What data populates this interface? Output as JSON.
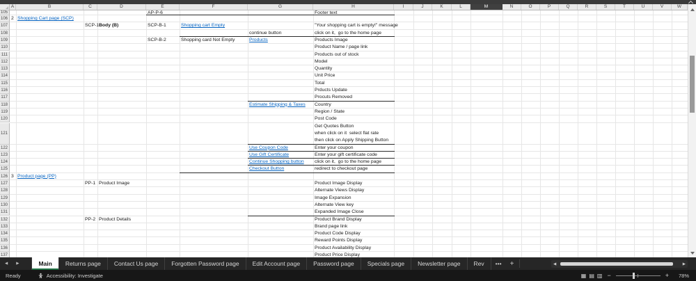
{
  "colors": {
    "link": "#0563c1",
    "selected_column_header_bg": "#404040",
    "section_border": "#2b2b2b",
    "active_tab_underline": "#1f7244",
    "frame_dark": "#262626"
  },
  "frame": {
    "tabs": {
      "nav_left": "◀",
      "nav_right": "▶",
      "items": [
        "Main",
        "Returns page",
        "Contact Us page",
        "Forgotten Password page",
        "Edit Account page",
        "Password page",
        "Specials page",
        "Newsletter page",
        "Rev"
      ],
      "active": "Main",
      "overflow": "•••",
      "add": "+"
    },
    "status": {
      "ready": "Ready",
      "accessibility": "Accessibility: Investigate",
      "zoom_out": "−",
      "zoom_in": "+",
      "zoom": "78%"
    }
  },
  "sheet": {
    "selected_column": "M",
    "columns": [
      "A",
      "B",
      "C",
      "D",
      "E",
      "F",
      "G",
      "H",
      "I",
      "J",
      "K",
      "L",
      "M",
      "N",
      "O",
      "P",
      "Q",
      "R",
      "S",
      "T",
      "U",
      "V",
      "W"
    ],
    "rows": [
      {
        "n": 105,
        "h": 7,
        "cells": [
          {
            "c": "E",
            "t": "AP-P-6"
          },
          {
            "c": "H",
            "t": "Footer text"
          }
        ],
        "border": [
          "E",
          "F",
          "G",
          "H"
        ]
      },
      {
        "n": 106,
        "cells": [
          {
            "c": "A",
            "t": "2"
          },
          {
            "c": "B",
            "t": "Shopping Cart page (SCP)",
            "link": true
          }
        ]
      },
      {
        "n": 107,
        "cells": [
          {
            "c": "C",
            "t": "SCP-1"
          },
          {
            "c": "D",
            "t": "Body (B)",
            "bold": true
          },
          {
            "c": "E",
            "t": "SCP-B-1"
          },
          {
            "c": "F",
            "t": "Shopping cart Empty",
            "link": true
          },
          {
            "c": "H",
            "t": "\"Your shopping cart is empty!\" message"
          }
        ]
      },
      {
        "n": 108,
        "cells": [
          {
            "c": "G",
            "t": "continue button"
          },
          {
            "c": "H",
            "t": "click on it,  go to the home page"
          }
        ],
        "border": [
          "F",
          "G",
          "H"
        ]
      },
      {
        "n": 109,
        "cells": [
          {
            "c": "E",
            "t": "SCP-B-2"
          },
          {
            "c": "F",
            "t": "Shopping card Not Empty"
          },
          {
            "c": "G",
            "t": "Products",
            "link": true
          },
          {
            "c": "H",
            "t": "Products Image"
          }
        ]
      },
      {
        "n": 110,
        "cells": [
          {
            "c": "H",
            "t": "Product Name / page link"
          }
        ]
      },
      {
        "n": 111,
        "cells": [
          {
            "c": "H",
            "t": "Products out of stock"
          }
        ]
      },
      {
        "n": 112,
        "cells": [
          {
            "c": "H",
            "t": "Model"
          }
        ]
      },
      {
        "n": 113,
        "cells": [
          {
            "c": "H",
            "t": "Quantity"
          }
        ]
      },
      {
        "n": 114,
        "cells": [
          {
            "c": "H",
            "t": "Unit Price"
          }
        ]
      },
      {
        "n": 115,
        "cells": [
          {
            "c": "H",
            "t": "Total"
          }
        ]
      },
      {
        "n": 116,
        "cells": [
          {
            "c": "H",
            "t": "Prducts Update"
          }
        ]
      },
      {
        "n": 117,
        "cells": [
          {
            "c": "H",
            "t": "Procuts Removed"
          }
        ],
        "border": [
          "G",
          "H"
        ]
      },
      {
        "n": 118,
        "cells": [
          {
            "c": "G",
            "t": "Estimate Shipping & Taxes",
            "link": true
          },
          {
            "c": "H",
            "t": "Country"
          }
        ]
      },
      {
        "n": 119,
        "cells": [
          {
            "c": "H",
            "t": "Region / State"
          }
        ]
      },
      {
        "n": 120,
        "cells": [
          {
            "c": "H",
            "t": "Post Code"
          }
        ]
      },
      {
        "n": 121,
        "h": 31,
        "cells": [
          {
            "c": "H",
            "t": "Get Quotes Button\nwhen click on it  select flat rate\nthen click on Apply Shipping Button"
          }
        ],
        "border": [
          "G",
          "H"
        ]
      },
      {
        "n": 122,
        "cells": [
          {
            "c": "G",
            "t": "Use Coupon Code",
            "link": true
          },
          {
            "c": "H",
            "t": "Enter your coupon"
          }
        ],
        "border": [
          "G",
          "H"
        ]
      },
      {
        "n": 123,
        "cells": [
          {
            "c": "G",
            "t": "Use Gift Certificate",
            "link": true
          },
          {
            "c": "H",
            "t": "Enter your gift certificate code"
          }
        ],
        "border": [
          "G",
          "H"
        ]
      },
      {
        "n": 124,
        "cells": [
          {
            "c": "G",
            "t": "Continue Shopping button",
            "link": true
          },
          {
            "c": "H",
            "t": "click on it,  go to the home page"
          }
        ],
        "border": [
          "G",
          "H"
        ]
      },
      {
        "n": 125,
        "cells": [
          {
            "c": "G",
            "t": "Checkout Button",
            "link": true
          },
          {
            "c": "H",
            "t": "redirect to checkout page"
          }
        ],
        "border": [
          "F",
          "G",
          "H"
        ]
      },
      {
        "n": 126,
        "cells": [
          {
            "c": "A",
            "t": "3"
          },
          {
            "c": "B",
            "t": "Product page (PP)",
            "link": true
          }
        ]
      },
      {
        "n": 127,
        "cells": [
          {
            "c": "C",
            "t": "PP-1"
          },
          {
            "c": "D",
            "t": "Product Image"
          },
          {
            "c": "H",
            "t": "Product Image Display"
          }
        ]
      },
      {
        "n": 128,
        "cells": [
          {
            "c": "H",
            "t": "Alternate Views Display"
          }
        ]
      },
      {
        "n": 129,
        "cells": [
          {
            "c": "H",
            "t": "Image Expansion"
          }
        ]
      },
      {
        "n": 130,
        "cells": [
          {
            "c": "H",
            "t": "Alternate View key"
          }
        ]
      },
      {
        "n": 131,
        "cells": [
          {
            "c": "H",
            "t": "Expanded Image Close"
          }
        ],
        "border": [
          "G",
          "H"
        ]
      },
      {
        "n": 132,
        "cells": [
          {
            "c": "C",
            "t": "PP-2"
          },
          {
            "c": "D",
            "t": "Product Details"
          },
          {
            "c": "H",
            "t": "Product Brand Display"
          }
        ]
      },
      {
        "n": 133,
        "cells": [
          {
            "c": "H",
            "t": "Brand page link"
          }
        ]
      },
      {
        "n": 134,
        "cells": [
          {
            "c": "H",
            "t": "Product Code Display"
          }
        ]
      },
      {
        "n": 135,
        "cells": [
          {
            "c": "H",
            "t": "Reward Points Display"
          }
        ]
      },
      {
        "n": 136,
        "cells": [
          {
            "c": "H",
            "t": "Product Availability Display"
          }
        ]
      },
      {
        "n": 137,
        "cells": [
          {
            "c": "H",
            "t": "Product Price Display"
          }
        ]
      }
    ]
  }
}
